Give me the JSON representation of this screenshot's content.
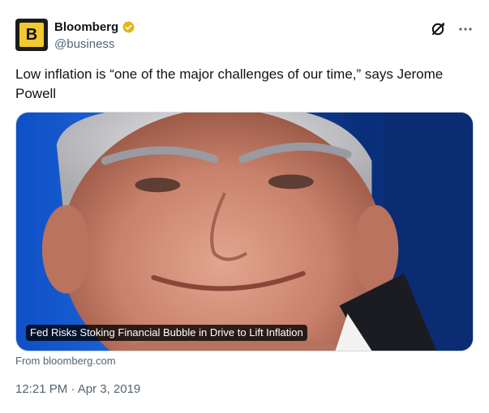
{
  "author": {
    "display_name": "Bloomberg",
    "handle": "@business",
    "avatar_letter": "B",
    "avatar_color": "#f2c92f",
    "verified_badge_color": "#e2b719"
  },
  "icons": {
    "grok": "grok-icon",
    "more": "more-horizontal-icon",
    "verified": "verified-badge-icon"
  },
  "tweet": {
    "text": "Low inflation is “one of the major challenges of our time,” says Jerome Powell"
  },
  "card": {
    "headline": "Fed Risks Stoking Financial Bubble in Drive to Lift Inflation",
    "source": "From bloomberg.com"
  },
  "meta": {
    "timestamp": "12:21 PM · Apr 3, 2019"
  }
}
